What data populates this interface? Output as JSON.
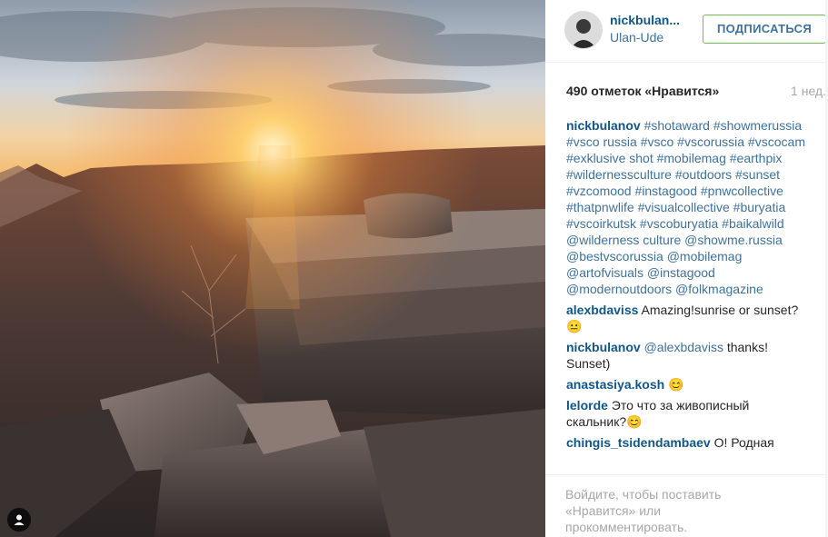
{
  "post": {
    "username": "nickbulan...",
    "location": "Ulan-Ude",
    "follow_label": "ПОДПИСАТЬСЯ",
    "likes": "490 отметок «Нравится»",
    "age": "1 нед."
  },
  "caption": {
    "author": "nickbulanov",
    "text": "#shotaward #showmerussia #vsco russia #vsco #vscorussia #vscocam #exklusive shot #mobilemag #earthpix #wildernessculture #outdoors #sunset #vzcomood #instagood #pnwcollective #thatpnwlife #visualcollective #buryatia #vscoirkutsk #vscoburyatia #baikalwild @wilderness culture @showme.russia @bestvscorussia @mobilemag @artofvisuals @instagood @modernoutdoors @folkmagazine"
  },
  "comments": [
    {
      "author": "alexbdaviss",
      "text": "Amazing!sunrise or sunset?😐"
    },
    {
      "author": "nickbulanov",
      "mention": "@alexbdaviss",
      "text": "thanks! Sunset)"
    },
    {
      "author": "anastasiya.kosh",
      "text": "😊"
    },
    {
      "author": "lelorde",
      "text": "Это что за живописный скальник?😊"
    },
    {
      "author": "chingis_tsidendambaev",
      "text": "О! Родная"
    }
  ],
  "footer": {
    "text": "Войдите, чтобы поставить «Нравится» или прокомментировать."
  },
  "icons": {
    "user_badge": "person-icon",
    "avatar": "profile-avatar"
  },
  "colors": {
    "username": "#125688",
    "link": "#3f729b",
    "follow_border": "#70c050",
    "meta": "#a5a7aa"
  }
}
